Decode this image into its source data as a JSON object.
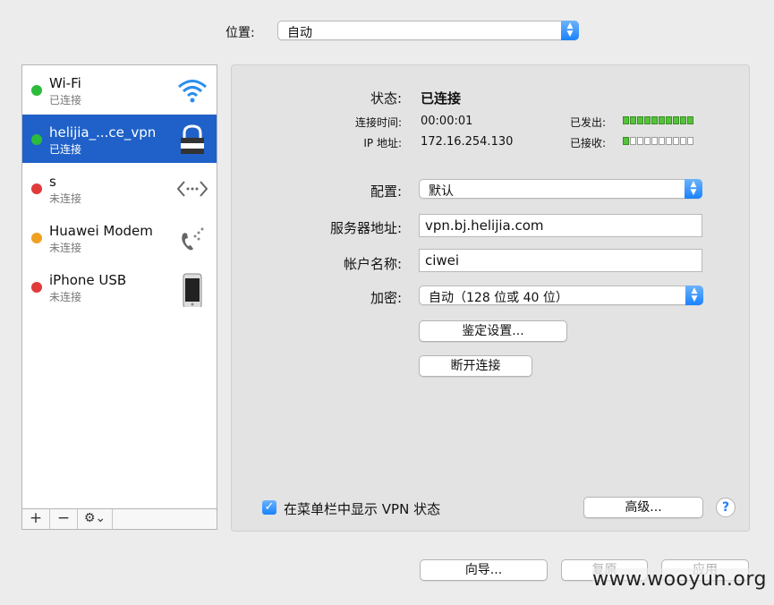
{
  "location": {
    "label": "位置:",
    "value": "自动"
  },
  "sidebar": {
    "services": [
      {
        "name": "Wi-Fi",
        "status": "已连接",
        "dot_color": "#2dbb3b",
        "icon": "wifi-icon",
        "selected": false
      },
      {
        "name": "helijia_...ce_vpn",
        "status": "已连接",
        "dot_color": "#2dbb3b",
        "icon": "vpn-lock-icon",
        "selected": true
      },
      {
        "name": "s",
        "status": "未连接",
        "dot_color": "#e03a3a",
        "icon": "ethernet-icon",
        "selected": false
      },
      {
        "name": "Huawei Modem",
        "status": "未连接",
        "dot_color": "#f0a020",
        "icon": "modem-phone-icon",
        "selected": false
      },
      {
        "name": "iPhone USB",
        "status": "未连接",
        "dot_color": "#e03a3a",
        "icon": "iphone-icon",
        "selected": false
      }
    ],
    "add_label": "+",
    "remove_label": "−",
    "gear_label": "⚙︎⌄"
  },
  "vpn": {
    "status_label": "状态:",
    "status_value": "已连接",
    "connect_time_label": "连接时间:",
    "connect_time_value": "00:00:01",
    "ip_label": "IP 地址:",
    "ip_value": "172.16.254.130",
    "sent_label": "已发出:",
    "received_label": "已接收:",
    "sent_level": 1.0,
    "received_level": 0.1,
    "config_label": "配置:",
    "config_value": "默认",
    "server_label": "服务器地址:",
    "server_value": "vpn.bj.helijia.com",
    "account_label": "帐户名称:",
    "account_value": "ciwei",
    "encryption_label": "加密:",
    "encryption_value": "自动（128 位或 40 位）",
    "auth_button": "鉴定设置...",
    "disconnect_button": "断开连接",
    "show_status_label": "在菜单栏中显示 VPN 状态",
    "show_status_checked": true,
    "advanced_button": "高级...",
    "help_label": "?"
  },
  "footer": {
    "assist_button": "向导...",
    "revert_button": "复原",
    "apply_button": "应用"
  },
  "watermark": "www.wooyun.org"
}
